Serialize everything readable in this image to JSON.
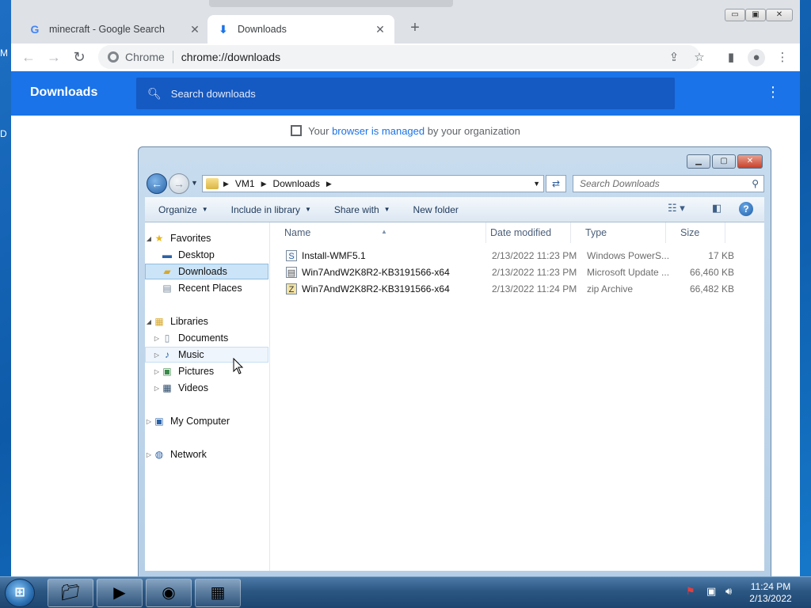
{
  "browser": {
    "tabs": [
      {
        "title": "minecraft - Google Search",
        "favicon": "G"
      },
      {
        "title": "Downloads",
        "favicon": "⬇"
      }
    ],
    "close_glyph": "✕",
    "new_tab_glyph": "+",
    "window_controls": {
      "minimize": "▭",
      "restore": "▣",
      "close": "✕"
    },
    "omnibox": {
      "chip": "Chrome",
      "url": "chrome://downloads"
    },
    "page": {
      "title": "Downloads",
      "search_placeholder": "Search downloads",
      "managed_prefix": "Your",
      "managed_link": "browser is managed",
      "managed_suffix": "by your organization"
    }
  },
  "explorer": {
    "address": [
      "VM1",
      "Downloads"
    ],
    "search_placeholder": "Search Downloads",
    "commands": [
      "Organize",
      "Include in library",
      "Share with",
      "New folder"
    ],
    "nav": {
      "favorites": {
        "label": "Favorites",
        "items": [
          "Desktop",
          "Downloads",
          "Recent Places"
        ]
      },
      "libraries": {
        "label": "Libraries",
        "items": [
          "Documents",
          "Music",
          "Pictures",
          "Videos"
        ]
      },
      "computer": "My Computer",
      "network": "Network"
    },
    "columns": [
      "Name",
      "Date modified",
      "Type",
      "Size"
    ],
    "files": [
      {
        "name": "Install-WMF5.1",
        "date": "2/13/2022 11:23 PM",
        "type": "Windows PowerS...",
        "size": "17 KB"
      },
      {
        "name": "Win7AndW2K8R2-KB3191566-x64",
        "date": "2/13/2022 11:23 PM",
        "type": "Microsoft Update ...",
        "size": "66,460 KB"
      },
      {
        "name": "Win7AndW2K8R2-KB3191566-x64",
        "date": "2/13/2022 11:24 PM",
        "type": "zip Archive",
        "size": "66,482 KB"
      }
    ]
  },
  "taskbar": {
    "time": "11:24 PM",
    "date": "2/13/2022"
  },
  "colors": {
    "chrome_accent": "#1a73e8",
    "selection": "#cce4f7",
    "taskbar": "#2c5783"
  }
}
